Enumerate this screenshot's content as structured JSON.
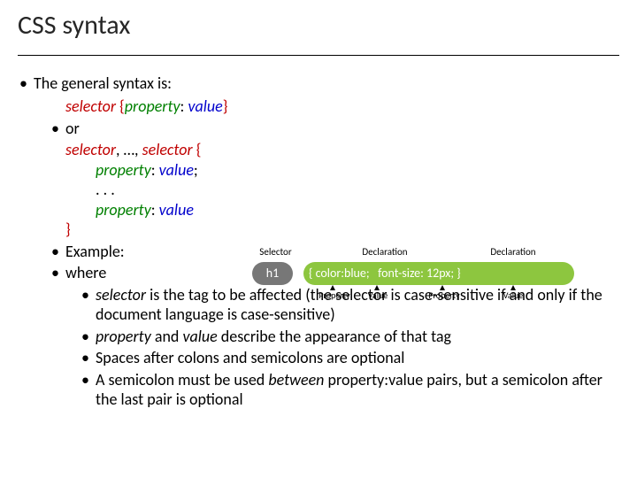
{
  "title": "CSS syntax",
  "bullets": {
    "general": "The general syntax is:",
    "or": "or",
    "example": "Example:",
    "where": "where",
    "w1_a": "selector",
    "w1_b": " is the tag to be affected (the selector is case-sensitive if and only if the document language is case-sensitive)",
    "w2_a": "property",
    "w2_b": " and ",
    "w2_c": "value",
    "w2_d": " describe the appearance of that tag",
    "w3": "Spaces after colons and semicolons are optional",
    "w4_a": "A semicolon must be used ",
    "w4_b": "between",
    "w4_c": " property:value pairs, but a semicolon after the last pair is optional"
  },
  "syntax1": {
    "selector": "selector",
    "lb": " {",
    "property": "property",
    "colon": ": ",
    "value": "value",
    "rb": "}"
  },
  "syntax2": {
    "line1_a": "selector",
    "line1_b": ", …, ",
    "line1_c": "selector",
    "line1_d": " {",
    "line2_a": "property",
    "line2_b": ": ",
    "line2_c": "value",
    "line2_d": ";",
    "line3": ". . .",
    "line4_a": "property",
    "line4_b": ": ",
    "line4_c": "value",
    "line5": "}"
  },
  "diagram": {
    "top_selector": "Selector",
    "top_decl": "Declaration",
    "h1": "h1",
    "rule_open": "{",
    "rule_d1": "color:blue;",
    "rule_d2": "font-size: 12px;",
    "rule_close": "}",
    "bot_property": "Property",
    "bot_value": "Value"
  }
}
